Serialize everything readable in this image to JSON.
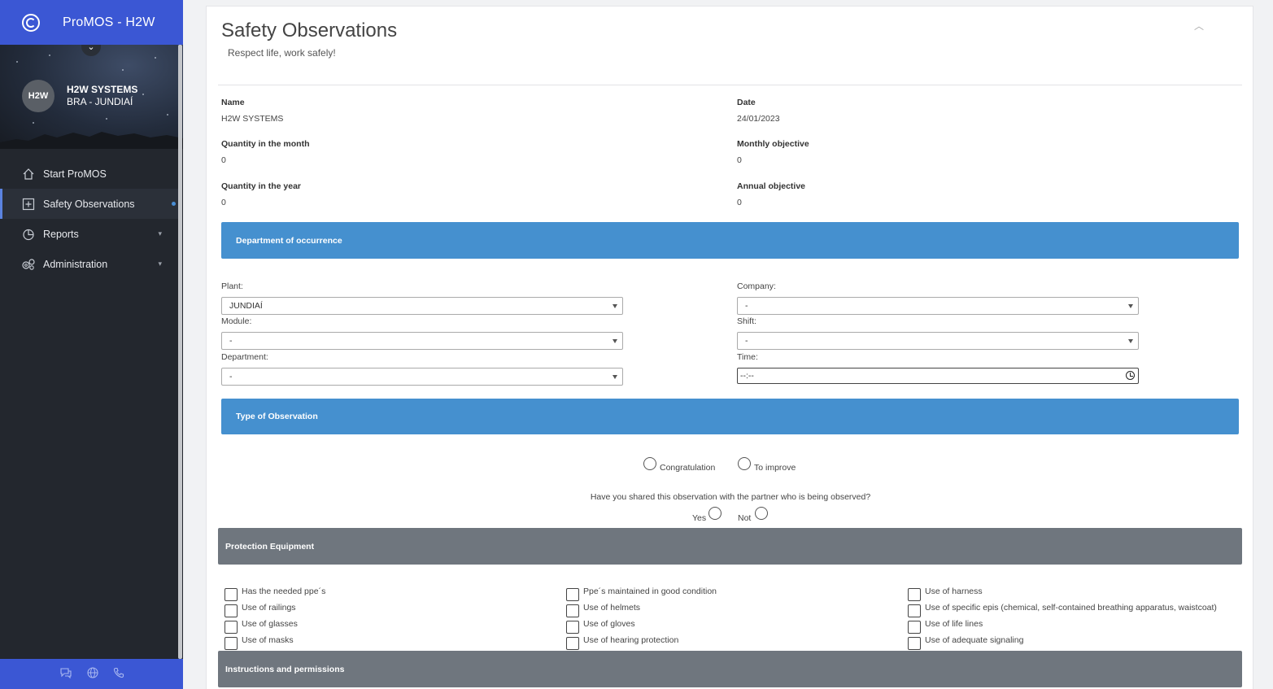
{
  "app": {
    "title": "ProMOS - H2W"
  },
  "profile": {
    "avatar": "H2W",
    "name": "H2W SYSTEMS",
    "location": "BRA - JUNDIAÍ"
  },
  "nav": {
    "items": [
      {
        "label": "Start ProMOS",
        "icon": "home-icon"
      },
      {
        "label": "Safety Observations",
        "icon": "plus-square-icon",
        "active": true
      },
      {
        "label": "Reports",
        "icon": "pie-chart-icon",
        "has_children": true
      },
      {
        "label": "Administration",
        "icon": "gears-icon",
        "has_children": true
      }
    ]
  },
  "footer_icons": [
    "chat-icon",
    "globe-icon",
    "phone-icon"
  ],
  "page": {
    "title": "Safety Observations",
    "subtitle": "Respect life, work safely!"
  },
  "info": {
    "name_label": "Name",
    "name_value": "H2W SYSTEMS",
    "date_label": "Date",
    "date_value": "24/01/2023",
    "qty_month_label": "Quantity in the month",
    "qty_month_value": "0",
    "monthly_obj_label": "Monthly objective",
    "monthly_obj_value": "0",
    "qty_year_label": "Quantity in the year",
    "qty_year_value": "0",
    "annual_obj_label": "Annual objective",
    "annual_obj_value": "0"
  },
  "department_section": {
    "title": "Department of occurrence",
    "plant_label": "Plant:",
    "plant_value": "JUNDIAÍ",
    "company_label": "Company:",
    "company_value": "-",
    "module_label": "Module:",
    "module_value": "-",
    "shift_label": "Shift:",
    "shift_value": "-",
    "department_label": "Department:",
    "department_value": "-",
    "time_label": "Time:",
    "time_value": "--:--"
  },
  "observation_section": {
    "title": "Type of Observation",
    "option_congratulation": "Congratulation",
    "option_improve": "To improve",
    "question": "Have you shared this observation with the partner who is being observed?",
    "answer_yes": "Yes",
    "answer_not": "Not"
  },
  "protection_section": {
    "title": "Protection Equipment",
    "col1": [
      "Has the needed ppe´s",
      "Use of railings",
      "Use of glasses",
      "Use of masks"
    ],
    "col2": [
      "Ppe´s maintained in good condition",
      "Use of helmets",
      "Use of gloves",
      "Use of hearing protection"
    ],
    "col3": [
      "Use of harness",
      "Use of specific epis (chemical, self-contained breathing apparatus, waistcoat)",
      "Use of life lines",
      "Use of adequate signaling"
    ]
  },
  "instructions_section": {
    "title": "Instructions and permissions"
  },
  "colors": {
    "brand": "#3b57d4",
    "sidebar": "#23272e",
    "section_blue": "#4590cf",
    "section_gray": "#6f767e"
  }
}
